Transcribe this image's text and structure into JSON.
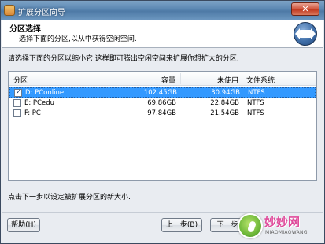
{
  "window": {
    "title": "扩展分区向导"
  },
  "header": {
    "title": "分区选择",
    "subtitle": "选择下面的分区,以从中获得空闲空间."
  },
  "instruction": "请选择下面的分区以缩小它,这样即可腾出空闲空间来扩展你想扩大的分区.",
  "table": {
    "columns": [
      "分区",
      "容量",
      "未使用",
      "文件系统"
    ],
    "rows": [
      {
        "name": "D: PConline",
        "capacity": "102.45GB",
        "free": "30.94GB",
        "fs": "NTFS",
        "checked": true,
        "selected": true
      },
      {
        "name": "E: PCedu",
        "capacity": "69.86GB",
        "free": "22.84GB",
        "fs": "NTFS",
        "checked": false,
        "selected": false
      },
      {
        "name": "F: PC",
        "capacity": "97.84GB",
        "free": "21.54GB",
        "fs": "NTFS",
        "checked": false,
        "selected": false
      }
    ]
  },
  "hint": "点击下一步以设定被扩展分区的新大小.",
  "buttons": {
    "help": "帮助(H)",
    "back": "上一步(B)",
    "next": "下一步(N)"
  },
  "watermark": {
    "text": "妙妙网",
    "sub": "MIAOMIAOWANG"
  },
  "colors": {
    "selection": "#3399ff",
    "titlebar": "#5a86b2"
  }
}
